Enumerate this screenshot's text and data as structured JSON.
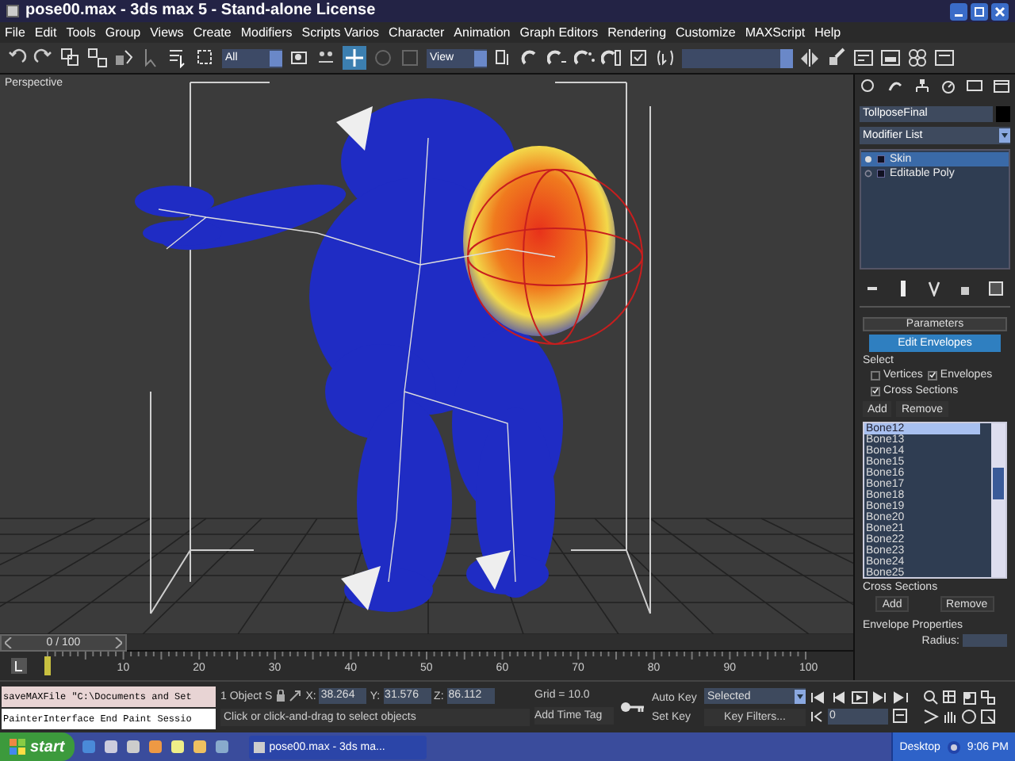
{
  "window": {
    "title": "pose00.max - 3ds max 5 - Stand-alone License"
  },
  "menu": [
    "File",
    "Edit",
    "Tools",
    "Group",
    "Views",
    "Create",
    "Modifiers",
    "Scripts Varios",
    "Character",
    "Animation",
    "Graph Editors",
    "Rendering",
    "Customize",
    "MAXScript",
    "Help"
  ],
  "toolbar": {
    "selection_filter": "All",
    "reference_coord": "View"
  },
  "viewport": {
    "label": "Perspective"
  },
  "command_panel": {
    "object_name": "TollposeFinal",
    "modifier_list": "Modifier List",
    "stack": [
      {
        "label": "Skin",
        "selected": true
      },
      {
        "label": "Editable Poly",
        "selected": false
      }
    ],
    "rollout_title": "Parameters",
    "edit_envelopes": "Edit Envelopes",
    "select_label": "Select",
    "checks": [
      {
        "label": "Vertices",
        "checked": false
      },
      {
        "label": "Envelopes",
        "checked": true
      },
      {
        "label": "Cross Sections",
        "checked": true
      }
    ],
    "add": "Add",
    "remove": "Remove",
    "bones": [
      {
        "label": "Bone12",
        "selected": true
      },
      {
        "label": "Bone13",
        "selected": false
      },
      {
        "label": "Bone14",
        "selected": false
      },
      {
        "label": "Bone15",
        "selected": false
      },
      {
        "label": "Bone16",
        "selected": false
      },
      {
        "label": "Bone17",
        "selected": false
      },
      {
        "label": "Bone18",
        "selected": false
      },
      {
        "label": "Bone19",
        "selected": false
      },
      {
        "label": "Bone20",
        "selected": false
      },
      {
        "label": "Bone21",
        "selected": false
      },
      {
        "label": "Bone22",
        "selected": false
      },
      {
        "label": "Bone23",
        "selected": false
      },
      {
        "label": "Bone24",
        "selected": false
      },
      {
        "label": "Bone25",
        "selected": false
      }
    ],
    "cross_sections_title": "Cross Sections",
    "cs_add": "Add",
    "cs_remove": "Remove",
    "envelope_properties": "Envelope Properties",
    "radius_label": "Radius:"
  },
  "timeline": {
    "frame": "0 / 100",
    "level": 0,
    "ticks": [
      "10",
      "20",
      "30",
      "40",
      "50",
      "60",
      "70",
      "80",
      "90",
      "100"
    ]
  },
  "status": {
    "maxscript": [
      "saveMAXFile \"C:\\Documents and Set",
      "PainterInterface End Paint Sessio"
    ],
    "selection": "1 Object S",
    "coords": [
      {
        "axis": "X:",
        "value": "38.264"
      },
      {
        "axis": "Y:",
        "value": "31.576"
      },
      {
        "axis": "Z:",
        "value": "86.112"
      }
    ],
    "prompt": "Click or click-and-drag to select objects",
    "grid": "Grid = 10.0",
    "add_time_tag": "Add Time Tag",
    "auto_key": "Auto Key",
    "key_mode": "Selected",
    "set_key": "Set Key",
    "key_filters": "Key Filters...",
    "frame_field": "0"
  },
  "taskbar": {
    "start": "start",
    "task": "pose00.max - 3ds ma...",
    "desktop": "Desktop",
    "time": "9:06 PM"
  }
}
